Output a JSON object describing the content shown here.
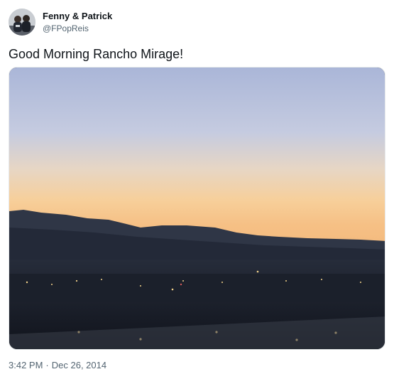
{
  "author": {
    "display_name": "Fenny & Patrick",
    "handle": "@FPopReis",
    "avatar_icon": "profile-photo-avatar"
  },
  "tweet": {
    "text": "Good Morning Rancho Mirage!"
  },
  "media": {
    "description_icon": "photo-sunrise-desert-mountains",
    "sky_top_color": "#aeb9d9",
    "sky_bottom_color": "#f6c58b",
    "mountain_color": "#2a3140",
    "ground_color": "#121620"
  },
  "meta": {
    "time": "3:42 PM",
    "separator": "·",
    "date": "Dec 26, 2014"
  }
}
